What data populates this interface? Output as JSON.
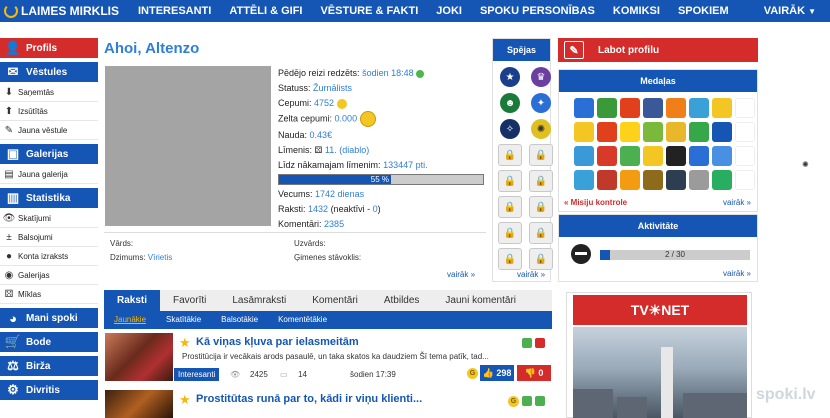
{
  "topnav": {
    "logo": "LAIMES MIRKLIS",
    "items": [
      "INTERESANTI",
      "ATTĒLI & GIFI",
      "VĒSTURE & FAKTI",
      "JOKI",
      "SPOKU PERSONĪBAS",
      "KOMIKSI",
      "SPOKIEM"
    ],
    "more": "VAIRĀK"
  },
  "leftnav": {
    "profils": "Profils",
    "vestules": "Vēstules",
    "sanemtas": "Saņemtās",
    "izsutitas": "Izsūtītās",
    "jauna_vestule": "Jauna vēstule",
    "galerijas": "Galerijas",
    "jauna_galerija": "Jauna galerija",
    "statistika": "Statistika",
    "skatijumi": "Skatījumi",
    "balsojumi": "Balsojumi",
    "konta_izraksts": "Konta izraksts",
    "galerijas_sub": "Galerijas",
    "miklas": "Mīklas",
    "mani_spoki": "Mani spoki",
    "bode": "Bode",
    "birza": "Birža",
    "divritis": "Divritis"
  },
  "profile": {
    "title": "Ahoi, Altenzo",
    "last_seen_label": "Pēdējo reizi redzēts:",
    "last_seen_value": "šodien 18:48",
    "status_label": "Statuss:",
    "status_value": "Žurnālists",
    "cepumi_label": "Cepumi:",
    "cepumi_value": "4752",
    "zelta_label": "Zelta cepumi:",
    "zelta_value": "0.000",
    "nauda_label": "Nauda:",
    "nauda_value": "0.43€",
    "limenis_label": "Līmenis:",
    "limenis_value": "11. (diablo)",
    "next_label": "Līdz nākamajam līmenim:",
    "next_value": "133447 pti.",
    "progress_text": "55 %",
    "progress_value": 55,
    "vecums_label": "Vecums:",
    "vecums_value": "1742 dienas",
    "raksti_label": "Raksti:",
    "raksti_value": "1432",
    "raksti_extra": " (neaktīvi - ",
    "raksti_inactive": "0",
    "raksti_close": ")",
    "komentari_label": "Komentāri:",
    "komentari_value": "2385",
    "vards_label": "Vārds:",
    "dzimums_label": "Dzimums:",
    "dzimums_value": "Vīrietis",
    "uzvards_label": "Uzvārds:",
    "gimenes_label": "Ģimenes stāvoklis:",
    "more": "vairāk »"
  },
  "spejas": {
    "title": "Spējas",
    "more": "vairāk »"
  },
  "medals": {
    "edit_button": "Labot profilu",
    "title": "Medaļas",
    "misiju": "« Misiju kontrole",
    "more": "vairāk »",
    "colors": [
      "#2a6fd6",
      "#3a9a3a",
      "#e0401c",
      "#3b5998",
      "#f07f1a",
      "#3aa0d8",
      "#f3c623",
      "#ffffff",
      "#f3c623",
      "#e0401c",
      "#ffd21a",
      "#7ab93c",
      "#e8b82a",
      "#35a84a",
      "#1556b4",
      "#ffffff",
      "#3a9ad8",
      "#d83a2a",
      "#4caf50",
      "#f3c623",
      "#222222",
      "#2a6fd6",
      "#4a90e2",
      "#ffffff",
      "#3aa0d8",
      "#c0392b",
      "#f39c12",
      "#8e6b1a",
      "#2c3e50",
      "#9b9b9b",
      "#27ae60",
      "#ffffff"
    ]
  },
  "activity": {
    "title": "Aktivitāte",
    "value_text": "2 / 30",
    "fraction": 0.067,
    "more": "vairāk »"
  },
  "tabs": {
    "items": [
      "Raksti",
      "Favorīti",
      "Lasāmraksti",
      "Komentāri",
      "Atbildes",
      "Jauni komentāri"
    ],
    "active": 0
  },
  "subtabs": {
    "items": [
      "Jaunākie",
      "Skatītākie",
      "Balsotākie",
      "Komentētākie"
    ],
    "active": 0
  },
  "articles": [
    {
      "title": "Kā viņas kļuva par ielasmeitām",
      "excerpt": "Prostitūcija ir vecākais arods pasaulē, un taka skatos ka daudziem Šī tema patīk, tad...",
      "category": "Interesanti",
      "views": "2425",
      "comments": "14",
      "date": "šodien 17:39",
      "likes": "298",
      "dislikes": "0"
    },
    {
      "title": "Prostitūtas runā par to, kādi ir viņu klienti..."
    }
  ],
  "ad": {
    "brand": "TV☀NET"
  },
  "watermark": "spoki.lv"
}
